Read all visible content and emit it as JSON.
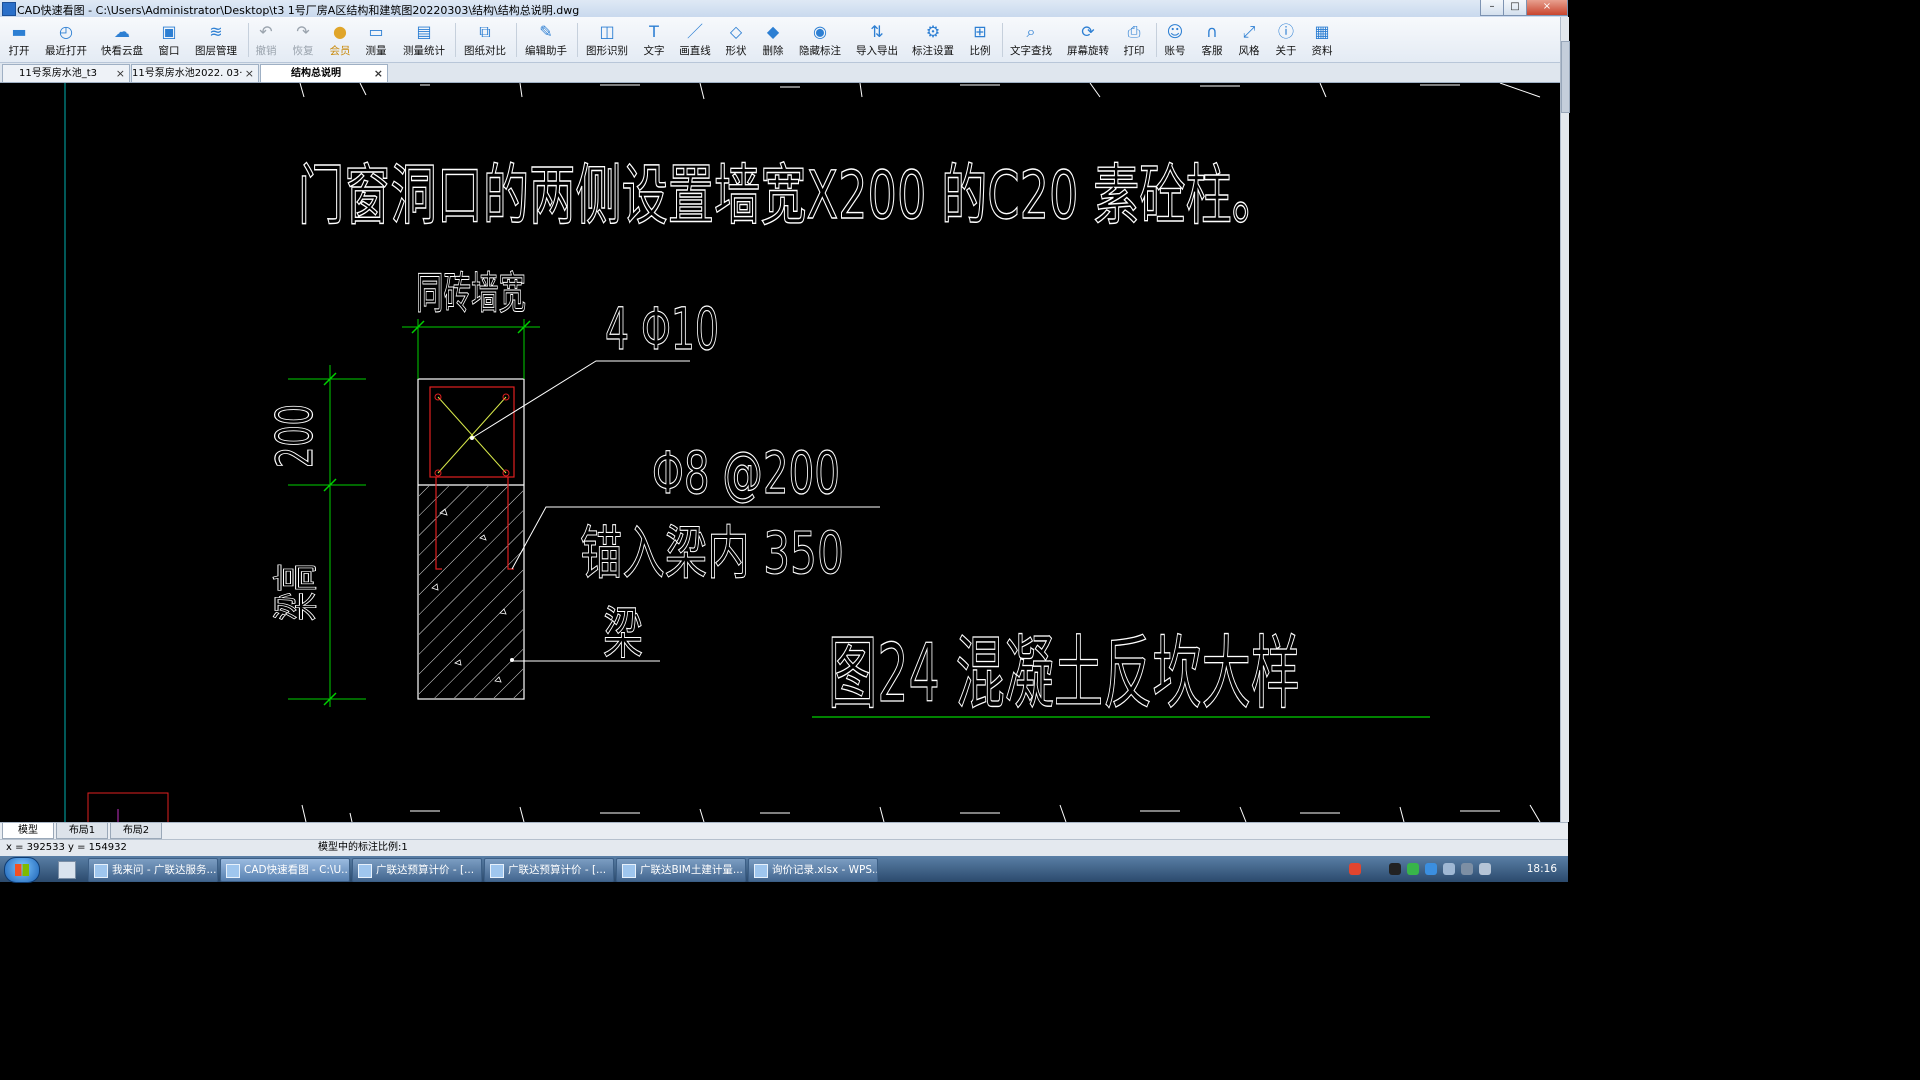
{
  "window": {
    "title": "CAD快速看图 - C:\\Users\\Administrator\\Desktop\\t3 1号厂房A区结构和建筑图20220303\\结构\\结构总说明.dwg",
    "controls": [
      "–",
      "□",
      "×"
    ]
  },
  "toolbar": {
    "items": [
      {
        "label": "打开",
        "icon": "folder-open-icon"
      },
      {
        "label": "最近打开",
        "icon": "clock-icon"
      },
      {
        "label": "快看云盘",
        "icon": "cloud-icon"
      },
      {
        "label": "窗口",
        "icon": "window-icon"
      },
      {
        "label": "图层管理",
        "icon": "layers-icon"
      },
      {
        "label": "撤销",
        "icon": "undo-icon",
        "disabled": true
      },
      {
        "label": "恢复",
        "icon": "redo-icon",
        "disabled": true
      },
      {
        "label": "会员",
        "icon": "vip-icon",
        "vip": true
      },
      {
        "label": "测量",
        "icon": "ruler-icon"
      },
      {
        "label": "测量统计",
        "icon": "measure-stats-icon"
      },
      {
        "label": "图纸对比",
        "icon": "compare-icon"
      },
      {
        "label": "编辑助手",
        "icon": "edit-assistant-icon"
      },
      {
        "label": "图形识别",
        "icon": "shape-recognition-icon"
      },
      {
        "label": "文字",
        "icon": "text-icon"
      },
      {
        "label": "画直线",
        "icon": "line-icon"
      },
      {
        "label": "形状",
        "icon": "shape-icon"
      },
      {
        "label": "删除",
        "icon": "eraser-icon"
      },
      {
        "label": "隐藏标注",
        "icon": "hide-annotation-icon"
      },
      {
        "label": "导入导出",
        "icon": "import-export-icon"
      },
      {
        "label": "标注设置",
        "icon": "annotation-settings-icon"
      },
      {
        "label": "比例",
        "icon": "scale-icon"
      },
      {
        "label": "文字查找",
        "icon": "text-search-icon"
      },
      {
        "label": "屏幕旋转",
        "icon": "rotate-screen-icon"
      },
      {
        "label": "打印",
        "icon": "printer-icon"
      },
      {
        "label": "账号",
        "icon": "user-icon"
      },
      {
        "label": "客服",
        "icon": "headset-icon"
      },
      {
        "label": "风格",
        "icon": "style-icon"
      },
      {
        "label": "关于",
        "icon": "info-icon"
      },
      {
        "label": "资料",
        "icon": "documents-icon"
      }
    ]
  },
  "tabs": [
    {
      "label": "11号泵房水池_t3",
      "close": "×"
    },
    {
      "label": "11号泵房水池2022. 03···",
      "close": "×"
    },
    {
      "label": "结构总说明",
      "close": "×",
      "active": true
    }
  ],
  "drawing": {
    "text_line1": "门窗洞口的两侧设置墙宽X200 的C20 素砼柱。",
    "label_wall_width": "同砖墙宽",
    "label_rebar_main": "4 Φ10",
    "label_dim_200": "200",
    "label_stirrup": "Φ8 @200",
    "label_anchor": "锚入梁内   350",
    "label_beam_height": "梁高",
    "label_beam": "梁",
    "figure_title": "图24   混凝土反坎大样"
  },
  "layout_tabs": [
    {
      "label": "模型",
      "active": true
    },
    {
      "label": "布局1"
    },
    {
      "label": "布局2"
    }
  ],
  "status": {
    "coords": "x = 392533  y = 154932",
    "scale": "模型中的标注比例:1"
  },
  "taskbar": {
    "items": [
      {
        "label": "我来问 - 广联达服务..."
      },
      {
        "label": "CAD快速看图 - C:\\U...",
        "active": true
      },
      {
        "label": "广联达预算计价 - [..."
      },
      {
        "label": "广联达预算计价 - [..."
      },
      {
        "label": "广联达BIM土建计量..."
      },
      {
        "label": "询价记录.xlsx - WPS..."
      }
    ],
    "clock": "18:16"
  },
  "colors": {
    "canvas_bg": "#000000",
    "drawing_line": "#ffffff",
    "dimension_line": "#00d000",
    "rebar_frame": "#e02020",
    "rebar_cross": "#d7e84a",
    "accent_blue": "#2d7fd3"
  }
}
